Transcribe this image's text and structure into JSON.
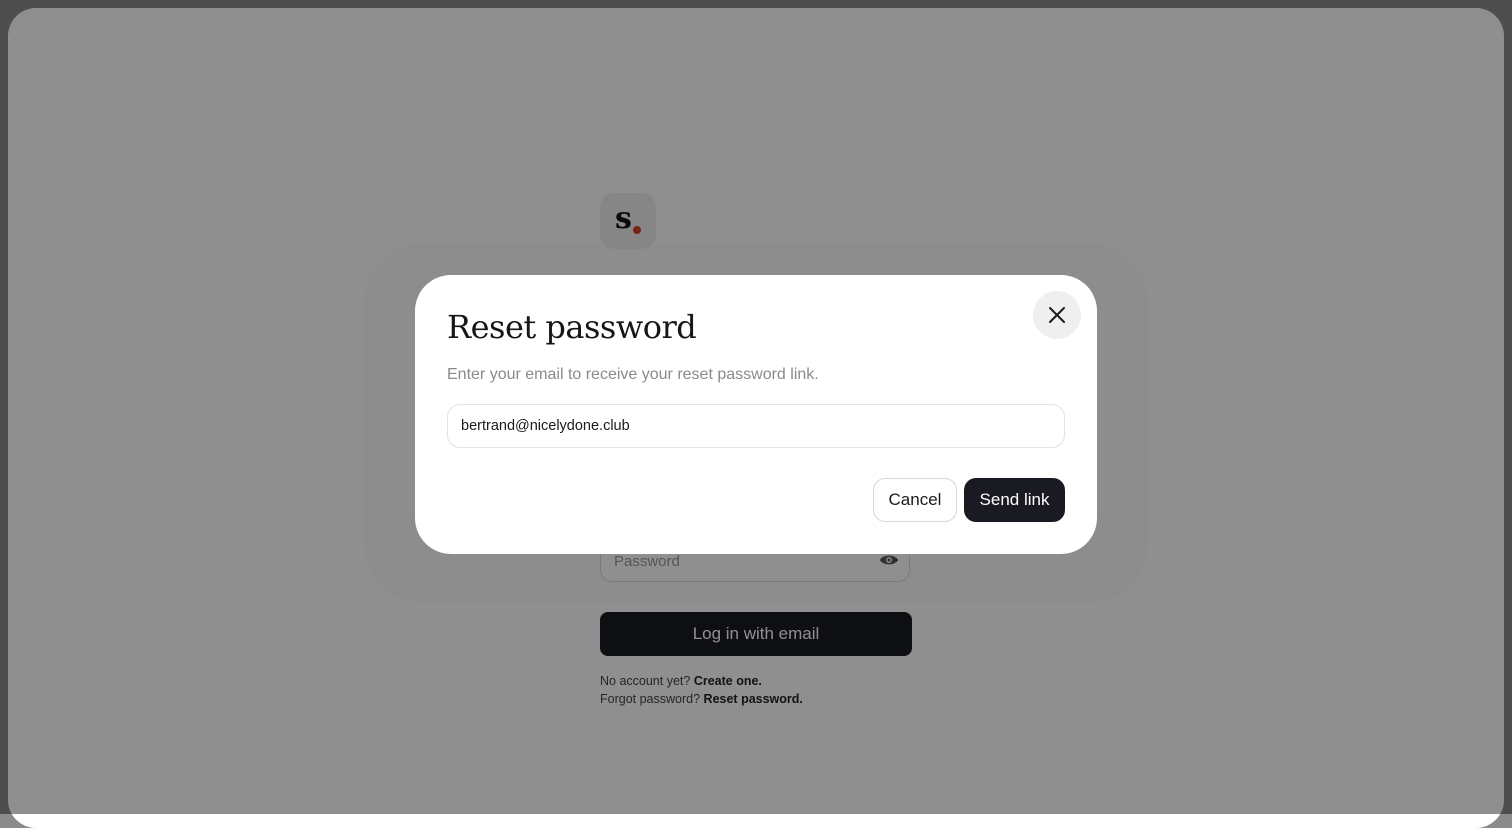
{
  "background_page": {
    "logo": {
      "letter": "s",
      "dot_color": "#d23c1f"
    },
    "password_field": {
      "placeholder": "Password",
      "icon": "eye-icon"
    },
    "login_button_label": "Log in with email",
    "signup_prompt": "No account yet?",
    "signup_link": "Create one.",
    "forgot_prompt": "Forgot password?",
    "reset_link": "Reset password."
  },
  "modal": {
    "title": "Reset password",
    "description": "Enter your email to receive your reset password link.",
    "email_value": "bertrand@nicelydone.club",
    "cancel_label": "Cancel",
    "send_label": "Send link",
    "close_icon": "close-icon"
  },
  "colors": {
    "primary_button": "#1a1b22",
    "overlay": "rgba(0,0,0,0.44)",
    "accent_dot": "#d23c1f"
  }
}
